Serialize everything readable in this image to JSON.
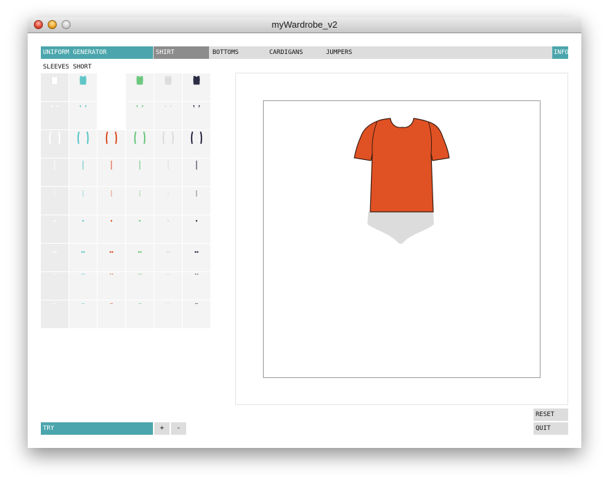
{
  "window": {
    "title": "myWardrobe_v2"
  },
  "tabs": {
    "uniform": "UNIFORM GENERATOR",
    "shirt": "SHIRT",
    "bottoms": "BOTTOMS",
    "cardigans": "CARDIGANS",
    "jumpers": "JUMPERS",
    "info": "INFO"
  },
  "sleeves_label": "SLEEVES SHORT",
  "colors": {
    "accent_teal": "#4aa6ac",
    "active_tab": "#8c8c8c",
    "shirt_orange": "#e05224",
    "briefs_grey": "#dcdcdc",
    "swatches": [
      "#ffffff",
      "#5fc5c7",
      "#dd5028",
      "#6cc77e",
      "#dcdcdc",
      "#2c2c44"
    ]
  },
  "palette_rows": [
    "body",
    "collar",
    "sleeves",
    "seam",
    "hem",
    "button",
    "buttons-pair",
    "dots-pair",
    "stitch"
  ],
  "preview": {
    "garment": "short-sleeve-shirt",
    "underlayer": "briefs"
  },
  "bottom": {
    "try_label": "TRY",
    "plus_label": "+",
    "minus_label": "-",
    "reset_label": "RESET",
    "quit_label": "QUIT"
  }
}
